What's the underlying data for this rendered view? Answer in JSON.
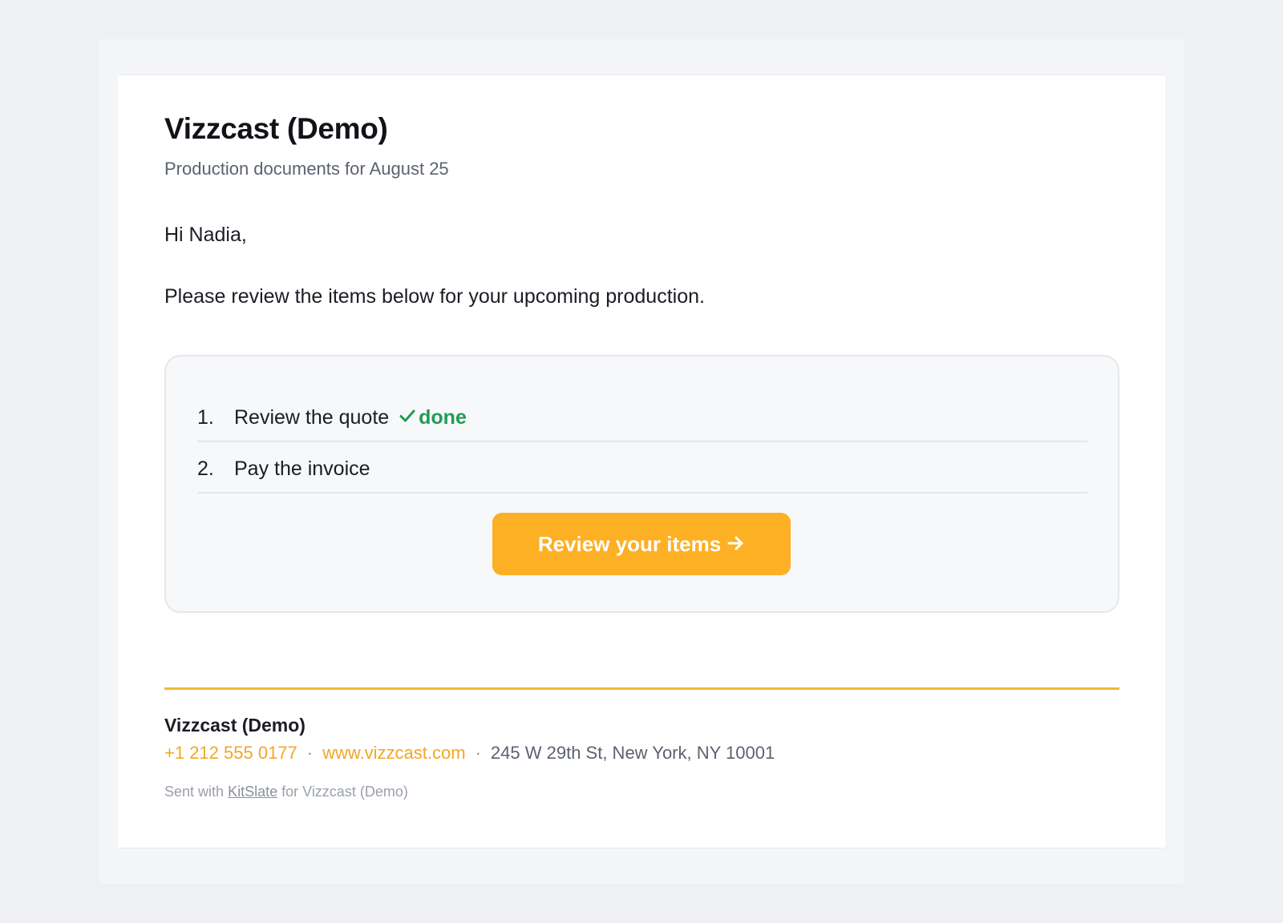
{
  "email": {
    "title": "Vizzcast (Demo)",
    "subtitle": "Production documents for August 25",
    "greeting": "Hi Nadia,",
    "intro": "Please review the items below for your upcoming production."
  },
  "items": [
    {
      "number": "1.",
      "label": "Review the quote",
      "status": "done",
      "status_icon": "check-icon"
    },
    {
      "number": "2.",
      "label": "Pay the invoice"
    }
  ],
  "cta": {
    "label": "Review your items",
    "icon": "arrow-right-icon",
    "color": "#fdb024"
  },
  "footer": {
    "company": "Vizzcast (Demo)",
    "phone": "+1 212 555 0177",
    "website": "www.vizzcast.com",
    "address": "245 W 29th St, New York, NY 10001",
    "separator": "·",
    "sent_prefix": "Sent with",
    "sent_brand": "KitSlate",
    "sent_suffix": "for Vizzcast (Demo)"
  },
  "colors": {
    "accent": "#fdb024",
    "done_green": "#1f9d55",
    "divider": "#f4b733"
  }
}
